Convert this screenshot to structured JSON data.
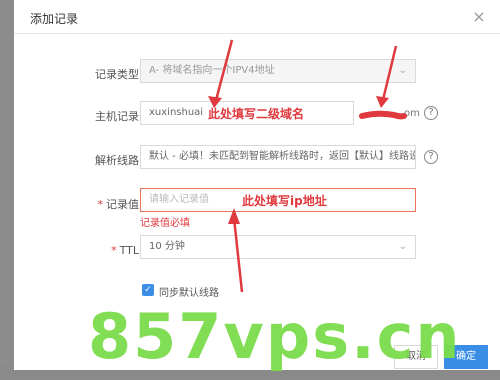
{
  "dialog": {
    "title": "添加记录",
    "close_glyph": "×"
  },
  "form": {
    "record_type": {
      "label": "记录类型：",
      "value": "A- 将域名指向一个IPV4地址"
    },
    "host": {
      "label": "主机记录：",
      "value": "xuxinshuai",
      "suffix": "om",
      "help": "?"
    },
    "line": {
      "label": "解析线路：",
      "value": "默认 - 必填！未匹配到智能解析线路时，返回【默认】线路设...",
      "help": "?"
    },
    "record_value": {
      "required_mark": "*",
      "label": "记录值：",
      "placeholder": "请输入记录值",
      "error": "记录值必填"
    },
    "ttl": {
      "required_mark": "*",
      "label": "TTL：",
      "value": "10 分钟"
    },
    "sync": {
      "checked": true,
      "label": "同步默认线路"
    }
  },
  "annotations": {
    "host_note": "此处填写二级域名",
    "value_note": "此处填写ip地址"
  },
  "buttons": {
    "cancel": "取消",
    "ok": "确定"
  },
  "watermark": "857vps.cn",
  "colors": {
    "primary": "#3a8ee6",
    "error": "#e0393e",
    "watermark": "#7bdc4a"
  }
}
